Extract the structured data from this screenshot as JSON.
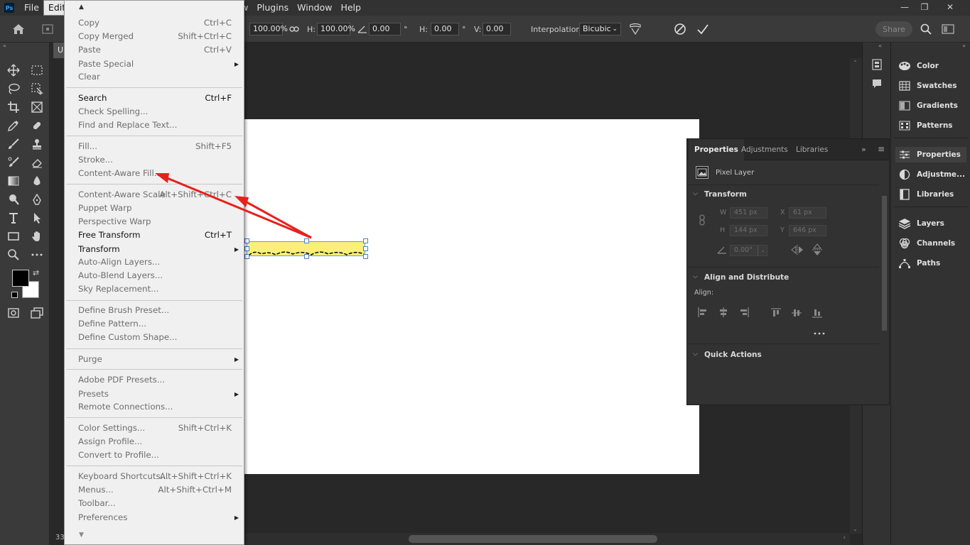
{
  "menubar": {
    "logo": "Ps",
    "items": [
      "File",
      "Edit",
      "w",
      "Plugins",
      "Window",
      "Help"
    ]
  },
  "window_controls": {
    "minimize": "—",
    "restore": "❐",
    "close": "✕"
  },
  "options_bar": {
    "width_value": "100.00%",
    "height_label": "H:",
    "height_value": "100.00%",
    "angle_value": "0.00",
    "angle_unit": "°",
    "hskew_label": "H:",
    "hskew_value": "0.00",
    "hskew_unit": "°",
    "vskew_label": "V:",
    "vskew_value": "0.00",
    "interpolation_label": "Interpolation:",
    "interpolation_value": "Bicubic",
    "share_label": "Share"
  },
  "document": {
    "tab_label": "U",
    "zoom": "33",
    "highlight_color": "#fbef7a"
  },
  "edit_menu": {
    "items": [
      {
        "label": "Copy",
        "shortcut": "Ctrl+C",
        "enabled": false
      },
      {
        "label": "Copy Merged",
        "shortcut": "Shift+Ctrl+C",
        "enabled": false
      },
      {
        "label": "Paste",
        "shortcut": "Ctrl+V",
        "enabled": false
      },
      {
        "label": "Paste Special",
        "shortcut": "",
        "enabled": false,
        "submenu": true
      },
      {
        "label": "Clear",
        "shortcut": "",
        "enabled": false
      },
      {
        "label": "Search",
        "shortcut": "Ctrl+F",
        "enabled": true
      },
      {
        "label": "Check Spelling...",
        "shortcut": "",
        "enabled": false
      },
      {
        "label": "Find and Replace Text...",
        "shortcut": "",
        "enabled": false
      },
      {
        "label": "Fill...",
        "shortcut": "Shift+F5",
        "enabled": false
      },
      {
        "label": "Stroke...",
        "shortcut": "",
        "enabled": false
      },
      {
        "label": "Content-Aware Fill...",
        "shortcut": "",
        "enabled": false
      },
      {
        "label": "Content-Aware Scale",
        "shortcut": "Alt+Shift+Ctrl+C",
        "enabled": false
      },
      {
        "label": "Puppet Warp",
        "shortcut": "",
        "enabled": false
      },
      {
        "label": "Perspective Warp",
        "shortcut": "",
        "enabled": false
      },
      {
        "label": "Free Transform",
        "shortcut": "Ctrl+T",
        "enabled": true
      },
      {
        "label": "Transform",
        "shortcut": "",
        "enabled": true,
        "submenu": true
      },
      {
        "label": "Auto-Align Layers...",
        "shortcut": "",
        "enabled": false
      },
      {
        "label": "Auto-Blend Layers...",
        "shortcut": "",
        "enabled": false
      },
      {
        "label": "Sky Replacement...",
        "shortcut": "",
        "enabled": false
      },
      {
        "label": "Define Brush Preset...",
        "shortcut": "",
        "enabled": false
      },
      {
        "label": "Define Pattern...",
        "shortcut": "",
        "enabled": false
      },
      {
        "label": "Define Custom Shape...",
        "shortcut": "",
        "enabled": false
      },
      {
        "label": "Purge",
        "shortcut": "",
        "enabled": false,
        "submenu": true
      },
      {
        "label": "Adobe PDF Presets...",
        "shortcut": "",
        "enabled": false
      },
      {
        "label": "Presets",
        "shortcut": "",
        "enabled": false,
        "submenu": true
      },
      {
        "label": "Remote Connections...",
        "shortcut": "",
        "enabled": false
      },
      {
        "label": "Color Settings...",
        "shortcut": "Shift+Ctrl+K",
        "enabled": false
      },
      {
        "label": "Assign Profile...",
        "shortcut": "",
        "enabled": false
      },
      {
        "label": "Convert to Profile...",
        "shortcut": "",
        "enabled": false
      },
      {
        "label": "Keyboard Shortcuts...",
        "shortcut": "Alt+Shift+Ctrl+K",
        "enabled": false
      },
      {
        "label": "Menus...",
        "shortcut": "Alt+Shift+Ctrl+M",
        "enabled": false
      },
      {
        "label": "Toolbar...",
        "shortcut": "",
        "enabled": false
      },
      {
        "label": "Preferences",
        "shortcut": "",
        "enabled": false,
        "submenu": true
      }
    ]
  },
  "properties_panel": {
    "tabs": [
      "Properties",
      "Adjustments",
      "Libraries"
    ],
    "layer_type": "Pixel Layer",
    "transform": {
      "title": "Transform",
      "w_label": "W",
      "w_value": "451 px",
      "x_label": "X",
      "x_value": "61 px",
      "h_label": "H",
      "h_value": "144 px",
      "y_label": "Y",
      "y_value": "646 px",
      "angle_value": "0.00°"
    },
    "align": {
      "title": "Align and Distribute",
      "label": "Align:"
    },
    "quick_actions": {
      "title": "Quick Actions"
    }
  },
  "dock": {
    "items": [
      "Color",
      "Swatches",
      "Gradients",
      "Patterns",
      "Properties",
      "Adjustme...",
      "Libraries",
      "Layers",
      "Channels",
      "Paths"
    ]
  },
  "annotation_color": "#e8201c"
}
